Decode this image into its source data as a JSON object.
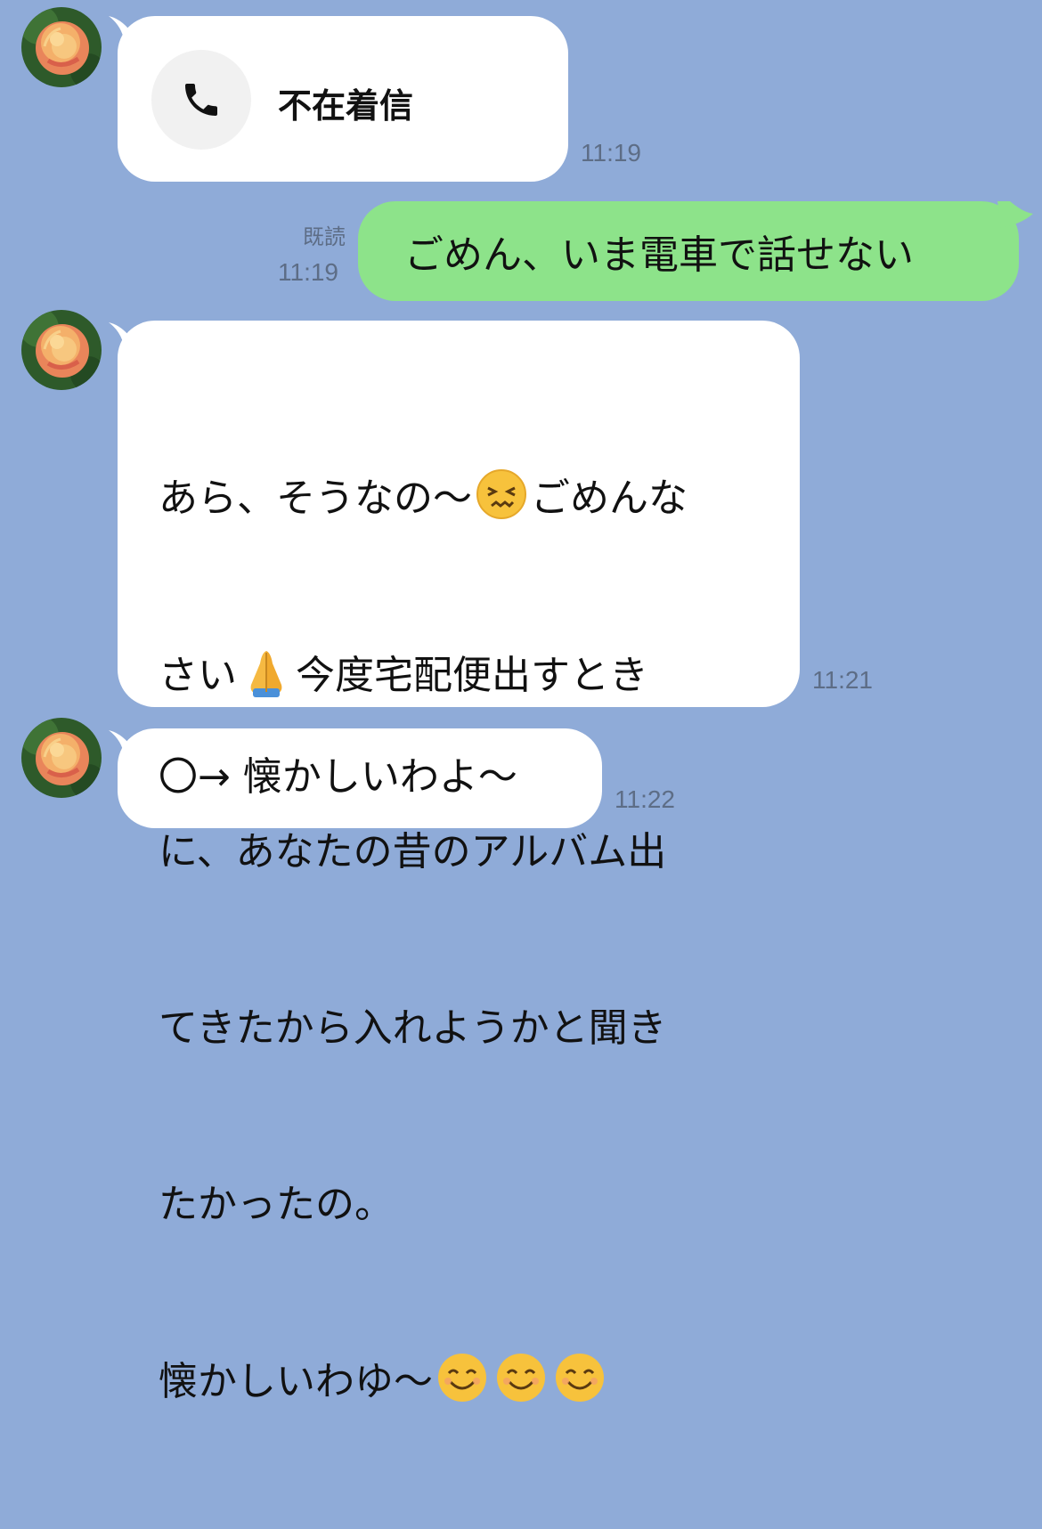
{
  "messages": [
    {
      "type": "missed_call",
      "label": "不在着信",
      "time": "11:19",
      "icon": "phone-icon"
    },
    {
      "type": "sent",
      "text": "ごめん、いま電車で話せない",
      "read_label": "既読",
      "time": "11:19"
    },
    {
      "type": "received",
      "line1a": "あら、そうなの〜",
      "emoji1": "confounded-face-emoji",
      "line1b": "ごめんな",
      "line2a": "さい",
      "emoji2": "folded-hands-emoji",
      "line2b": "今度宅配便出すとき",
      "line3": "に、あなたの昔のアルバム出",
      "line4": "てきたから入れようかと聞き",
      "line5": "たかったの。",
      "line6": "懐かしいわゆ〜",
      "emoji3": "smiling-face-emoji",
      "time": "11:21"
    },
    {
      "type": "received",
      "text": "〇→ 懐かしいわよ〜",
      "time": "11:22"
    }
  ],
  "colors": {
    "background": "#8fabd8",
    "sent_bubble": "#8de38a",
    "received_bubble": "#ffffff",
    "time_text": "#5d6d86"
  }
}
